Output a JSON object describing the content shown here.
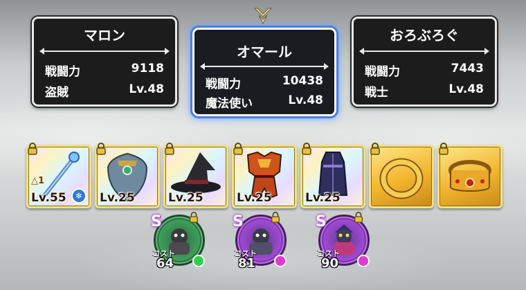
{
  "party": [
    {
      "name": "マロン",
      "power_label": "戦闘力",
      "power": "9118",
      "job": "盗賊",
      "level": "Lv.48"
    },
    {
      "name": "オマール",
      "power_label": "戦闘力",
      "power": "10438",
      "job": "魔法使い",
      "level": "Lv.48"
    },
    {
      "name": "おろぶろぐ",
      "power_label": "戦闘力",
      "power": "7443",
      "job": "戦士",
      "level": "Lv.48"
    }
  ],
  "equipment": [
    {
      "icon": "staff-icon",
      "level": "Lv.55",
      "limit_break": "1",
      "frame": "rainbow"
    },
    {
      "icon": "shield-icon",
      "level": "Lv.25",
      "frame": "rainbow"
    },
    {
      "icon": "witch-hat-icon",
      "level": "Lv.25",
      "frame": "rainbow"
    },
    {
      "icon": "armor-icon",
      "level": "Lv.25",
      "frame": "rainbow"
    },
    {
      "icon": "robe-icon",
      "level": "Lv.25",
      "frame": "rainbow"
    },
    {
      "icon": "ring-icon",
      "level": "",
      "frame": "gold"
    },
    {
      "icon": "crown-ring-icon",
      "level": "",
      "frame": "gold"
    }
  ],
  "monsters": [
    {
      "rank": "S",
      "cost_label": "コスト",
      "cost": "64",
      "ring_color": "#3fa05a",
      "dot_color": "#2fd14a"
    },
    {
      "rank": "S",
      "cost_label": "コスト",
      "cost": "81",
      "ring_color": "#a24ad6",
      "dot_color": "#e23ad0"
    },
    {
      "rank": "S",
      "cost_label": "コスト",
      "cost": "90",
      "ring_color": "#a24ad6",
      "dot_color": "#e23ad0"
    }
  ]
}
